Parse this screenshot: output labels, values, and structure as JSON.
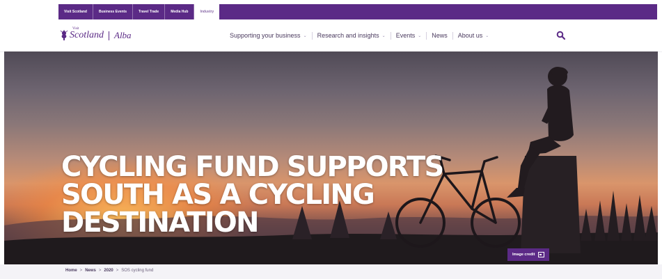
{
  "topbar": {
    "links": [
      "Visit Scotland",
      "Business Events",
      "Travel Trade",
      "Media Hub",
      "Industry"
    ]
  },
  "header": {
    "logo_small": "Visit",
    "logo_name": "Scotland",
    "logo_alt": "Alba",
    "nav": [
      {
        "label": "Supporting your business",
        "has_dropdown": true
      },
      {
        "label": "Research and insights",
        "has_dropdown": true
      },
      {
        "label": "Events",
        "has_dropdown": true
      },
      {
        "label": "News",
        "has_dropdown": false
      },
      {
        "label": "About us",
        "has_dropdown": true
      }
    ],
    "dropdown_glyph": "⌄"
  },
  "hero": {
    "title_lines": [
      "Cycling fund supports",
      "south as a cycling",
      "destination"
    ],
    "image_credit": "Image credit"
  },
  "breadcrumb": {
    "items": [
      "Home",
      "News",
      "2020"
    ],
    "separator": ">",
    "current": "SOS cycling fund"
  },
  "colors": {
    "brand_purple": "#5b2a86",
    "nav_text": "#4a3a5e",
    "breadcrumb_bg": "#f4f3f7"
  }
}
